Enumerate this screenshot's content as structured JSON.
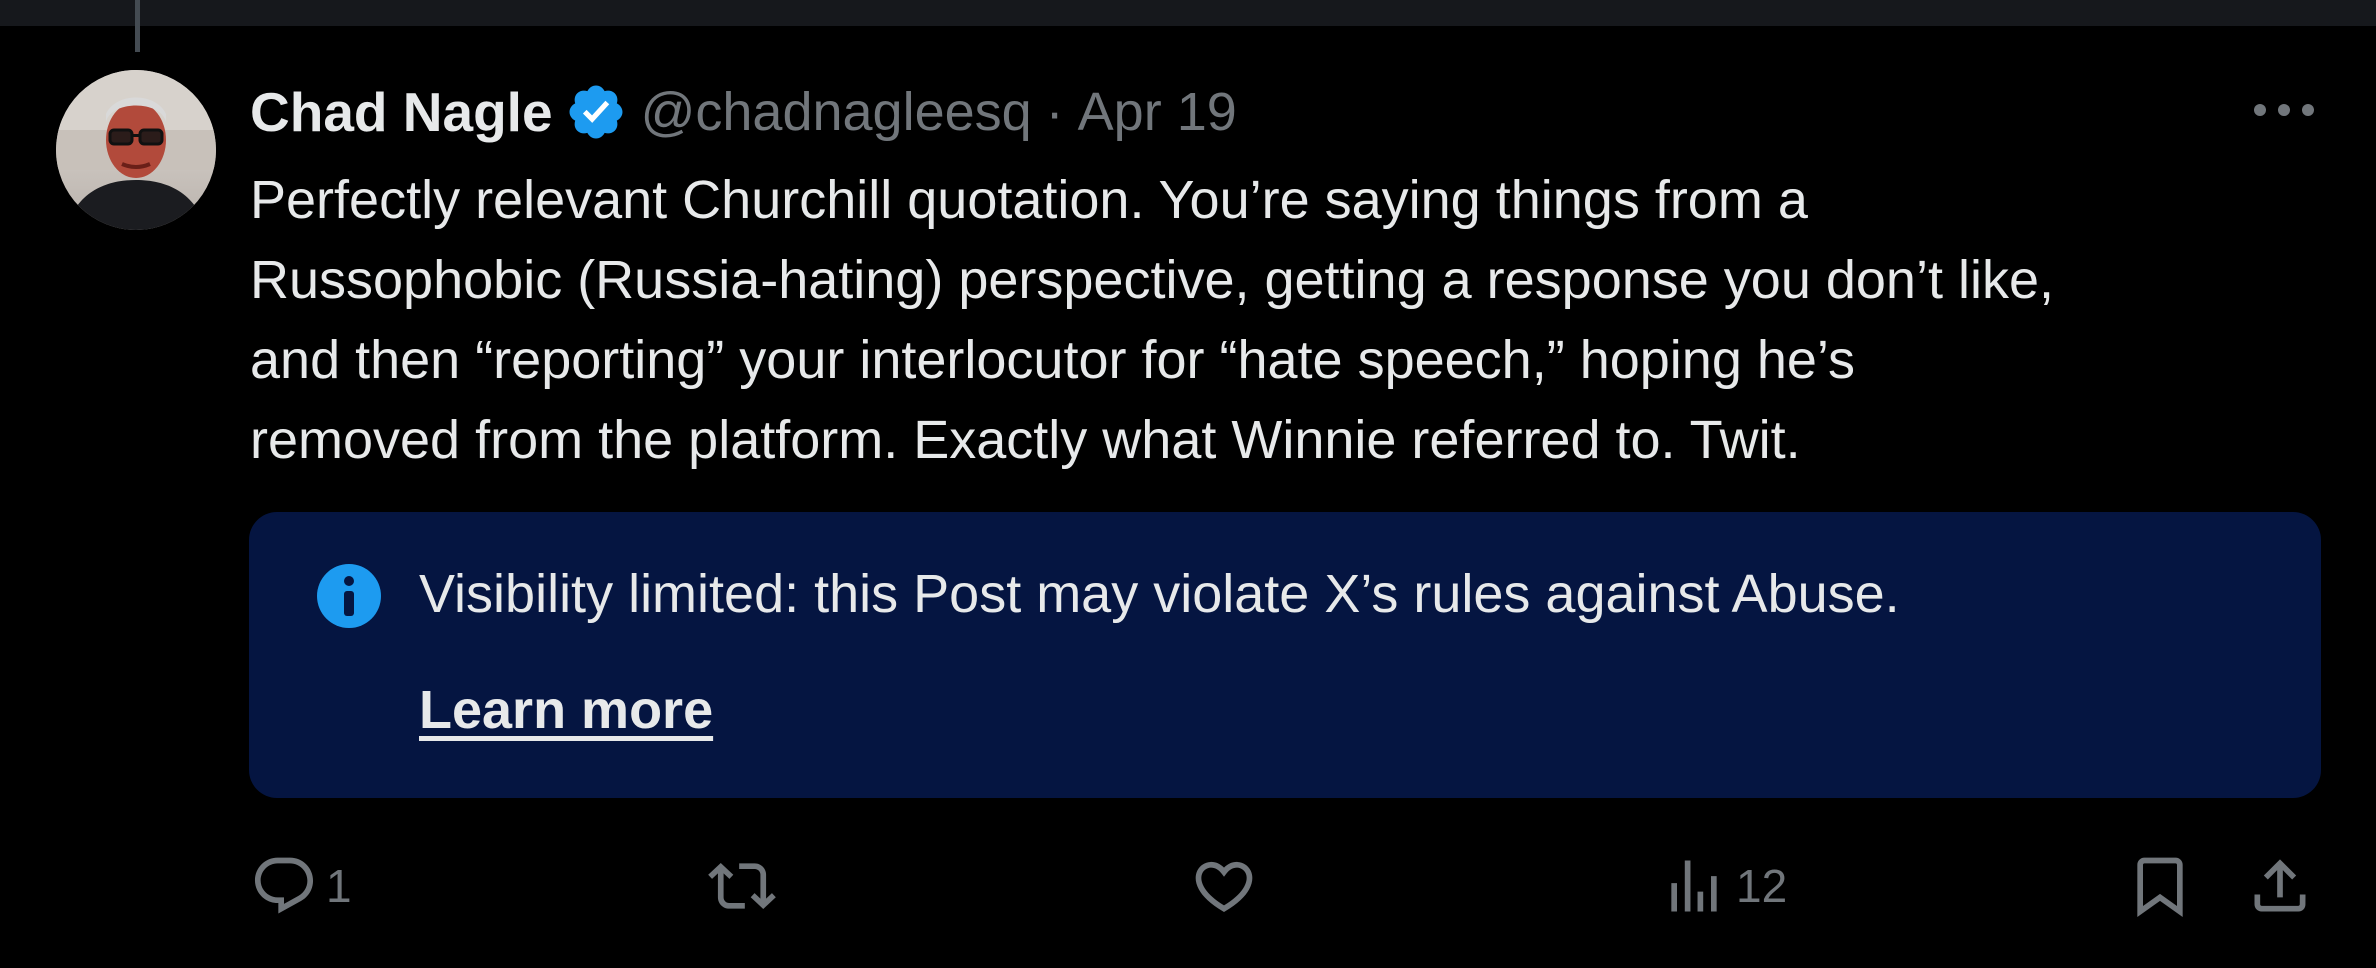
{
  "author": {
    "name": "Chad Nagle",
    "handle": "@chadnagleesq",
    "separator": "·",
    "date": "Apr 19",
    "verified_icon": "verified-badge-icon",
    "avatar": "avatar-photo"
  },
  "post": {
    "lines": [
      "Perfectly relevant Churchill quotation. You’re saying things from a",
      "Russophobic (Russia-hating) perspective, getting a response you don’t like,",
      "and then “reporting” your interlocutor for “hate speech,” hoping he’s",
      "removed from the platform. Exactly what Winnie referred to. Twit."
    ]
  },
  "notice": {
    "icon": "info-icon",
    "text": "Visibility limited: this Post may violate X’s rules against Abuse.",
    "link": "Learn more"
  },
  "actions": {
    "reply_count": "1",
    "views_count": "12",
    "icons": [
      "reply-icon",
      "repost-icon",
      "like-icon",
      "views-icon",
      "bookmark-icon",
      "share-icon"
    ]
  },
  "colors": {
    "background": "#000000",
    "text_primary": "#e7e9ea",
    "text_secondary": "#71767b",
    "verified_blue": "#1d9bf0",
    "notice_background": "#051541"
  }
}
